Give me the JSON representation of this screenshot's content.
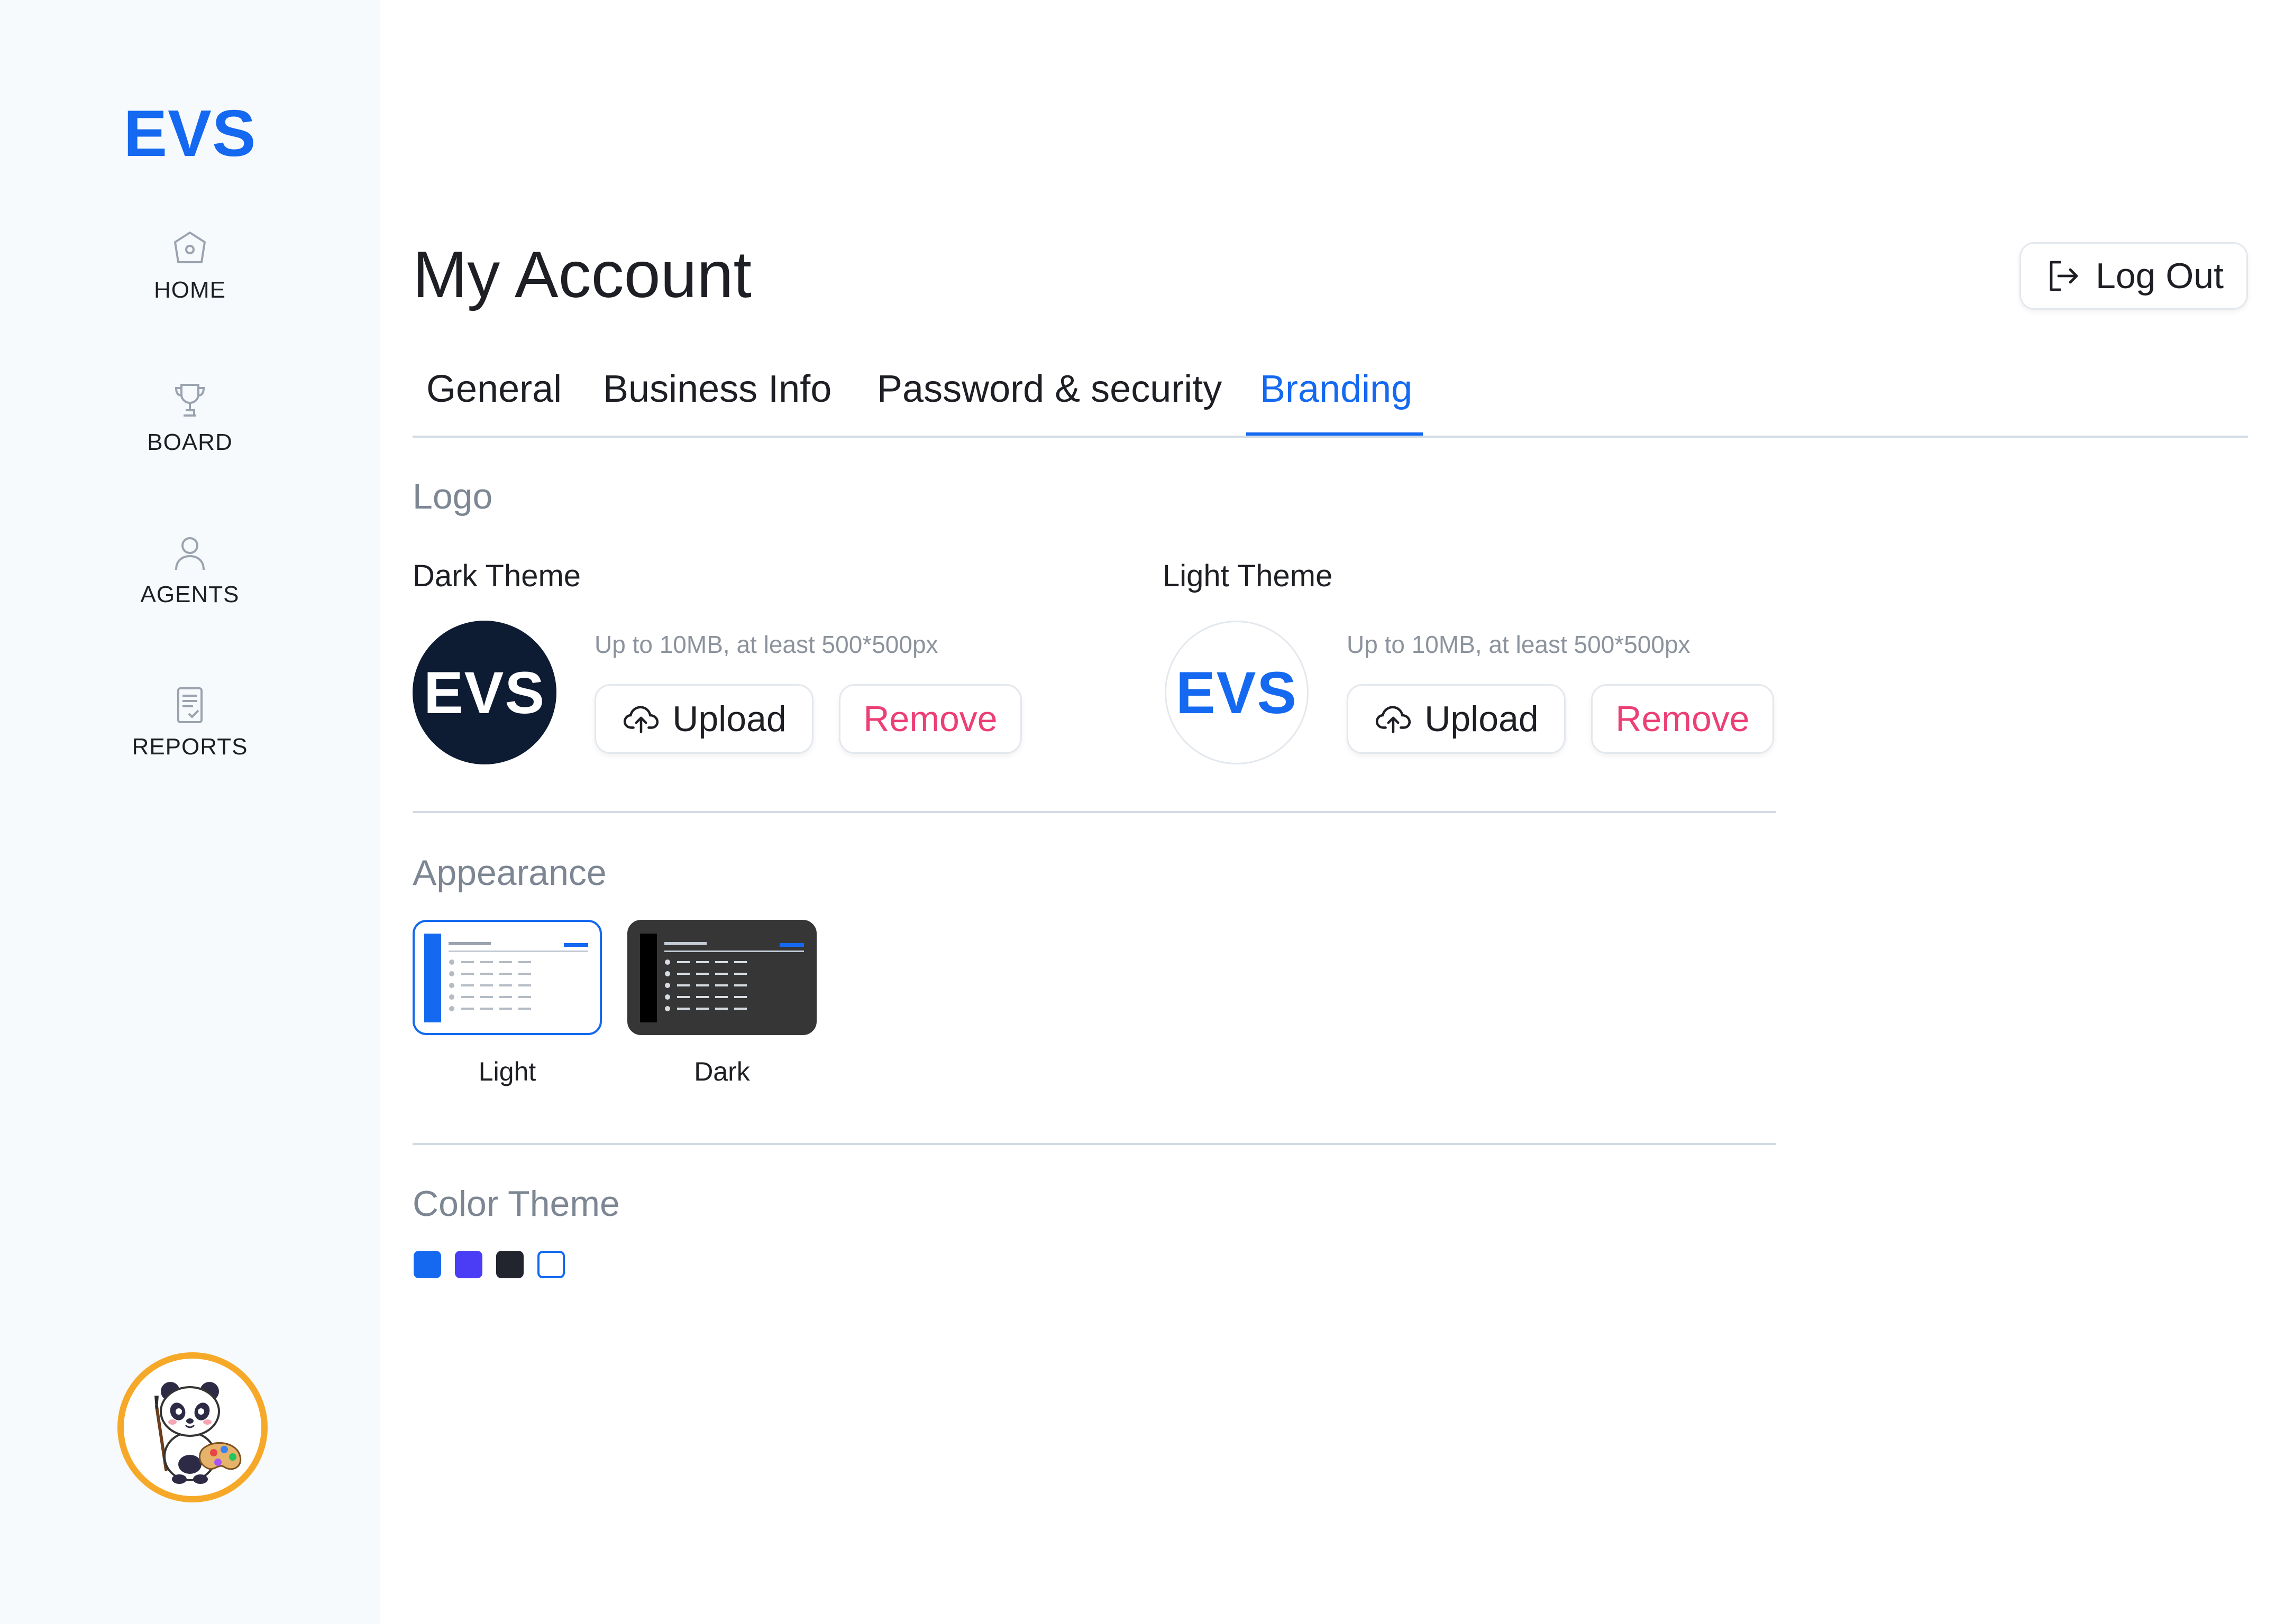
{
  "sidebar": {
    "brand": "EVS",
    "items": [
      {
        "label": "HOME",
        "icon": "home-icon"
      },
      {
        "label": "BOARD",
        "icon": "trophy-icon"
      },
      {
        "label": "AGENTS",
        "icon": "user-icon"
      },
      {
        "label": "REPORTS",
        "icon": "report-icon"
      }
    ],
    "avatar": "panda-painter-avatar"
  },
  "header": {
    "title": "My Account",
    "logout_label": "Log Out"
  },
  "tabs": [
    {
      "label": "General"
    },
    {
      "label": "Business Info"
    },
    {
      "label": "Password & security"
    },
    {
      "label": "Branding",
      "active": true
    }
  ],
  "logo_section": {
    "title": "Logo",
    "dark": {
      "title": "Dark Theme",
      "logo_text": "EVS",
      "hint": "Up to 10MB, at least 500*500px",
      "upload_label": "Upload",
      "remove_label": "Remove"
    },
    "light": {
      "title": "Light Theme",
      "logo_text": "EVS",
      "hint": "Up to 10MB, at least 500*500px",
      "upload_label": "Upload",
      "remove_label": "Remove"
    }
  },
  "appearance": {
    "title": "Appearance",
    "options": [
      {
        "label": "Light",
        "selected": true
      },
      {
        "label": "Dark",
        "selected": false
      }
    ]
  },
  "color_theme": {
    "title": "Color Theme",
    "swatches": [
      "#1469f0",
      "#4b3df5",
      "#22242e",
      "#ffffff"
    ]
  },
  "colors": {
    "accent": "#1469f0",
    "danger": "#ec3f75",
    "dark_logo_bg": "#0d1b33",
    "avatar_ring": "#f6a928"
  }
}
